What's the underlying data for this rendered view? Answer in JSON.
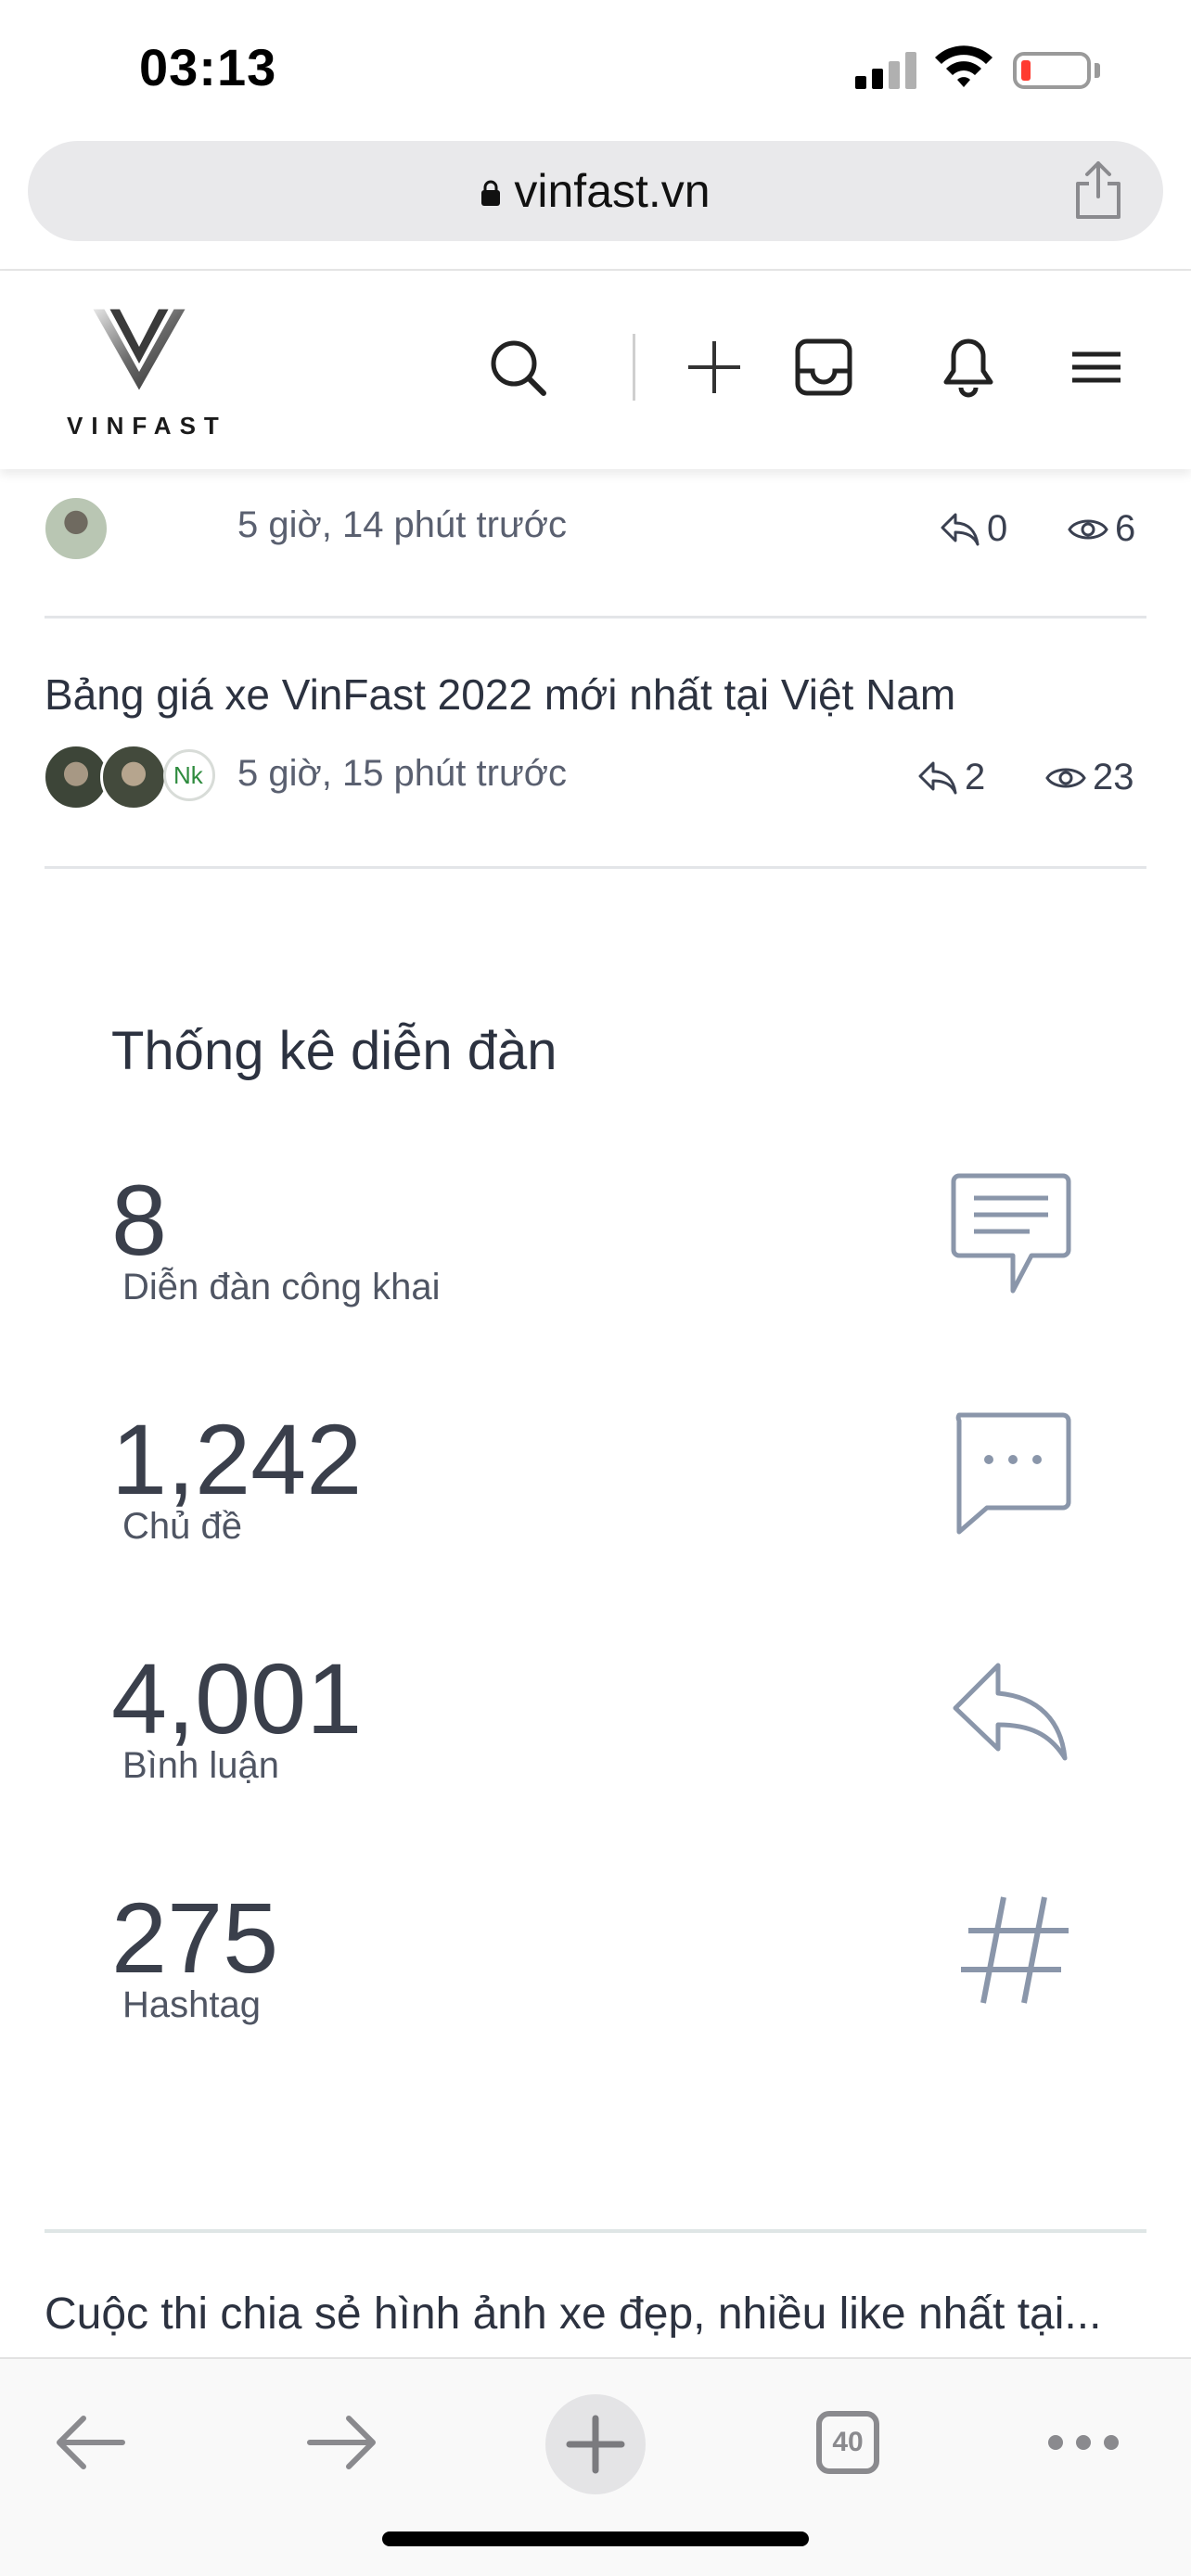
{
  "status_bar": {
    "time": "03:13"
  },
  "address_bar": {
    "url": "vinfast.vn"
  },
  "site_header": {
    "logo_text": "VINFAST"
  },
  "topics": [
    {
      "time": "5 giờ, 14 phút trước",
      "replies": "0",
      "views": "6"
    },
    {
      "title": "Bảng giá xe VinFast 2022 mới nhất tại Việt Nam",
      "time": "5 giờ, 15 phút trước",
      "replies": "2",
      "views": "23"
    }
  ],
  "forum_stats": {
    "title": "Thống kê diễn đàn",
    "items": [
      {
        "value": "8",
        "label": "Diễn đàn công khai",
        "icon": "forum-icon"
      },
      {
        "value": "1,242",
        "label": "Chủ đề",
        "icon": "chat-bubble-icon"
      },
      {
        "value": "4,001",
        "label": "Bình luận",
        "icon": "reply-icon"
      },
      {
        "value": "275",
        "label": "Hashtag",
        "icon": "hashtag-icon"
      }
    ]
  },
  "bottom_topic": {
    "title": "Cuộc thi chia sẻ hình ảnh xe đẹp, nhiều like nhất tại..."
  },
  "toolbar": {
    "tab_count": "40"
  },
  "colors": {
    "icon_accent": "#8a96aa",
    "text_primary": "#2c3240",
    "battery_low": "#ff3b30"
  }
}
